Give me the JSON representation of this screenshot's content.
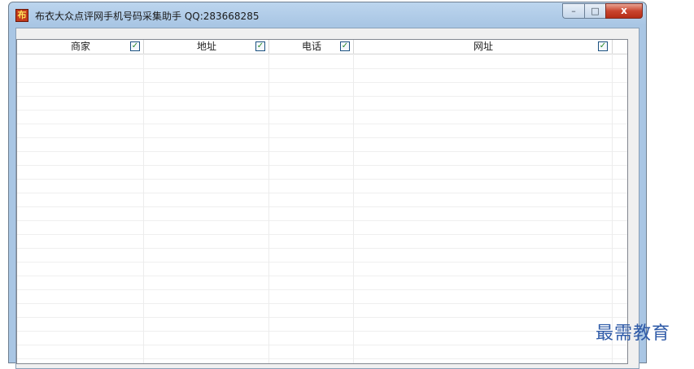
{
  "window": {
    "title": "布衣大众点评网手机号码采集助手 QQ:283668285",
    "app_icon_glyph": "布",
    "caption": {
      "minimize": "–",
      "maximize": "□",
      "close": "x"
    }
  },
  "listview": {
    "columns": [
      {
        "label": "商家",
        "checked": true,
        "check_glyph": "✓"
      },
      {
        "label": "地址",
        "checked": true,
        "check_glyph": "✓"
      },
      {
        "label": "电话",
        "checked": true,
        "check_glyph": "✓"
      },
      {
        "label": "网址",
        "checked": true,
        "check_glyph": "✓"
      }
    ],
    "rows": []
  },
  "watermark": {
    "text": "最需教育"
  },
  "colors": {
    "title_gradient": "#a9c6e4",
    "close_red": "#c9452f",
    "check_green": "#2a8a2a"
  }
}
